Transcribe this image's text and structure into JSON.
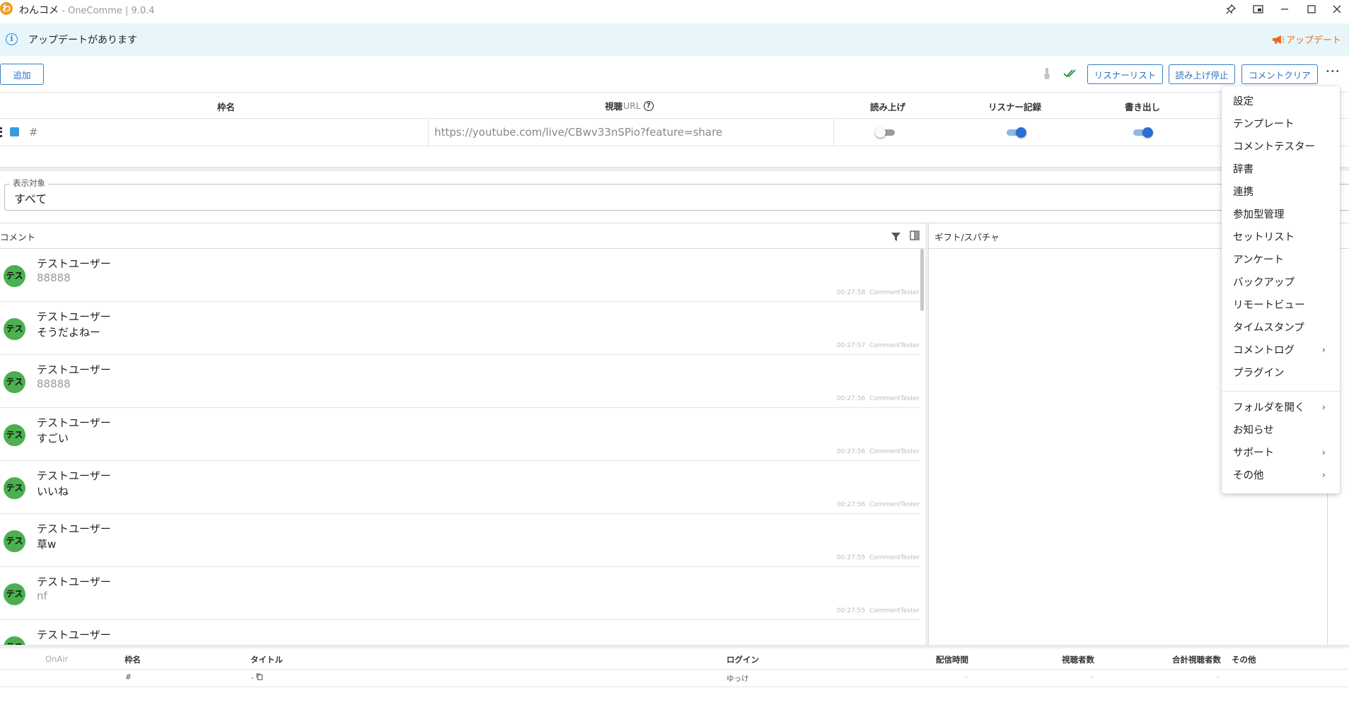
{
  "titlebar": {
    "logo_glyph": "わ",
    "app_name": "わんコメ",
    "app_subtitle": " - OneComme | 9.0.4",
    "icons": [
      "pin-icon",
      "picture-in-picture-icon",
      "minimize-icon",
      "maximize-icon",
      "close-icon"
    ]
  },
  "banner": {
    "info_glyph": "i",
    "text": "アップデートがあります",
    "update_label": "アップデート",
    "accent": "#ea6b1c"
  },
  "toolbar": {
    "add_label": "追加",
    "listener_list_label": "リスナーリスト",
    "stop_reading_label": "読み上げ停止",
    "clear_comments_label": "コメントクリア",
    "more_glyph": "•••"
  },
  "frames": {
    "headers": {
      "name": "枠名",
      "url": "視聴",
      "url_suffix": "URL",
      "read_aloud": "読み上げ",
      "listener_record": "リスナー記録",
      "export": "書き出し"
    },
    "row": {
      "name": "#",
      "url": "https://youtube.com/live/CBwv33nSPio?feature=share",
      "read_aloud": false,
      "listener_record": true,
      "export": true,
      "color": "#3a9bdc"
    }
  },
  "display_target": {
    "label": "表示対象",
    "value": "すべて"
  },
  "comments_panel": {
    "title": "コメント",
    "comments": [
      {
        "avatar": "テス",
        "user": "テストユーザー",
        "text": "88888",
        "faded": true,
        "time": "00:27:58",
        "source": "CommentTester"
      },
      {
        "avatar": "テス",
        "user": "テストユーザー",
        "text": "そうだよねー",
        "faded": false,
        "time": "00:27:57",
        "source": "CommentTester"
      },
      {
        "avatar": "テス",
        "user": "テストユーザー",
        "text": "88888",
        "faded": true,
        "time": "00:27:56",
        "source": "CommentTester"
      },
      {
        "avatar": "テス",
        "user": "テストユーザー",
        "text": "すごい",
        "faded": false,
        "time": "00:27:56",
        "source": "CommentTester"
      },
      {
        "avatar": "テス",
        "user": "テストユーザー",
        "text": "いいね",
        "faded": false,
        "time": "00:27:56",
        "source": "CommentTester"
      },
      {
        "avatar": "テス",
        "user": "テストユーザー",
        "text": "草w",
        "faded": false,
        "time": "00:27:55",
        "source": "CommentTester"
      },
      {
        "avatar": "テス",
        "user": "テストユーザー",
        "text": "nf",
        "faded": true,
        "time": "00:27:55",
        "source": "CommentTester"
      },
      {
        "avatar": "テス",
        "user": "テストユーザー",
        "text": "",
        "faded": false,
        "time": "",
        "source": ""
      }
    ]
  },
  "gifts_panel": {
    "title": "ギフト/スパチャ"
  },
  "menu": {
    "items": [
      {
        "label": "設定",
        "submenu": false
      },
      {
        "label": "テンプレート",
        "submenu": false
      },
      {
        "label": "コメントテスター",
        "submenu": false
      },
      {
        "label": "辞書",
        "submenu": false
      },
      {
        "label": "連携",
        "submenu": false
      },
      {
        "label": "参加型管理",
        "submenu": false
      },
      {
        "label": "セットリスト",
        "submenu": false
      },
      {
        "label": "アンケート",
        "submenu": false
      },
      {
        "label": "バックアップ",
        "submenu": false
      },
      {
        "label": "リモートビュー",
        "submenu": false
      },
      {
        "label": "タイムスタンプ",
        "submenu": false
      },
      {
        "label": "コメントログ",
        "submenu": true
      },
      {
        "label": "プラグイン",
        "submenu": false
      }
    ],
    "items2": [
      {
        "label": "フォルダを開く",
        "submenu": true
      },
      {
        "label": "お知らせ",
        "submenu": false
      },
      {
        "label": "サポート",
        "submenu": true
      },
      {
        "label": "その他",
        "submenu": true
      }
    ]
  },
  "status_table": {
    "headers": {
      "onair": "OnAir",
      "name": "枠名",
      "title": "タイトル",
      "login": "ログイン",
      "stream_time": "配信時間",
      "viewers": "視聴者数",
      "total_viewers": "合計視聴者数",
      "other": "その他"
    },
    "row": {
      "name": "#",
      "title": "-",
      "login": "ゆっけ",
      "stream_time": "-",
      "viewers": "-",
      "total_viewers": "-"
    }
  }
}
